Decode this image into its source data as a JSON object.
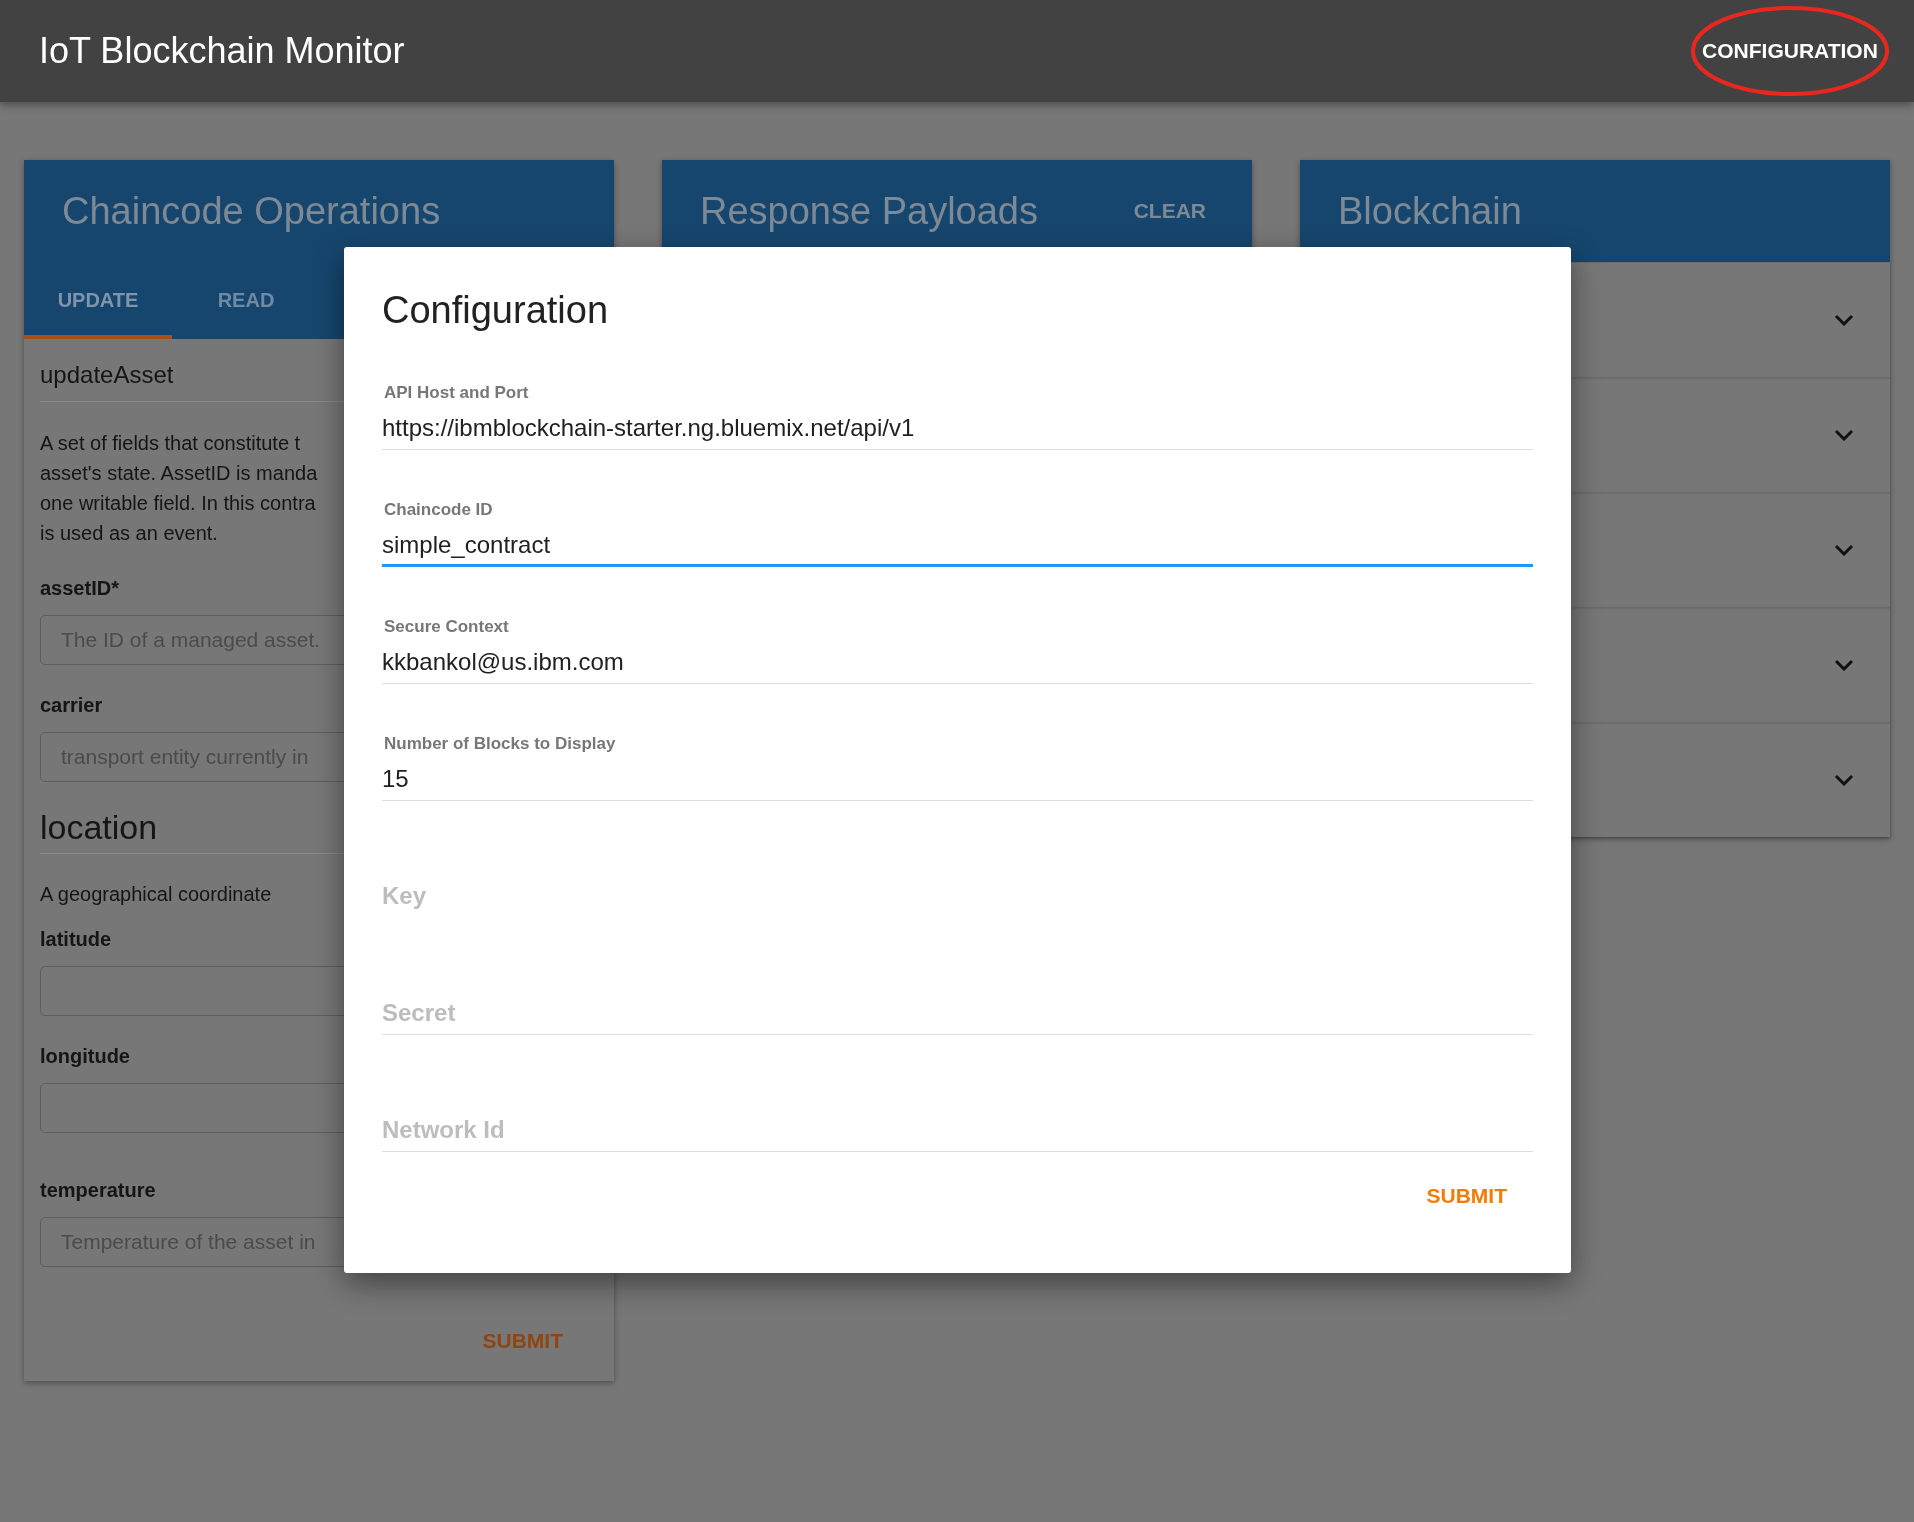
{
  "app_bar": {
    "title": "IoT Blockchain Monitor",
    "config_button": "CONFIGURATION",
    "highlighted": true
  },
  "panels": [
    {
      "kind": "operations",
      "title": "Chaincode Operations",
      "tabs": [
        {
          "label": "UPDATE",
          "selected": true
        },
        {
          "label": "READ",
          "selected": false
        }
      ],
      "function_name": "updateAsset",
      "description_lines": [
        "A set of fields that constitute t",
        "asset's state. AssetID is manda",
        "one writable field. In this contra",
        "is used as an event."
      ],
      "fields": [
        {
          "kind": "input",
          "label": "assetID*",
          "placeholder": "The ID of a managed asset."
        },
        {
          "kind": "input",
          "label": "carrier",
          "placeholder": "transport entity currently in"
        },
        {
          "kind": "section",
          "title": "location",
          "description": "A geographical coordinate",
          "children": [
            {
              "kind": "input",
              "label": "latitude"
            },
            {
              "kind": "input",
              "label": "longitude"
            }
          ]
        },
        {
          "kind": "input",
          "label": "temperature",
          "placeholder": "Temperature of the asset in"
        }
      ],
      "submit": "SUBMIT"
    },
    {
      "kind": "responses",
      "title": "Response Payloads",
      "action": "CLEAR"
    },
    {
      "kind": "blockchain",
      "title": "Blockchain",
      "blocks": [
        {
          "expanded": false
        },
        {
          "expanded": false
        },
        {
          "expanded": false
        },
        {
          "expanded": false
        },
        {
          "expanded": false
        }
      ]
    }
  ],
  "dialog": {
    "title": "Configuration",
    "fields": [
      {
        "label": "API Host and Port",
        "value": "https://ibmblockchain-starter.ng.bluemix.net/api/v1",
        "focused": false,
        "underlined": true
      },
      {
        "label": "Chaincode ID",
        "value": "simple_contract",
        "focused": true,
        "underlined": true
      },
      {
        "label": "Secure Context",
        "value": "kkbankol@us.ibm.com",
        "focused": false,
        "underlined": true
      },
      {
        "label": "Number of Blocks to Display",
        "value": "15",
        "focused": false,
        "underlined": true
      },
      {
        "placeholder": "Key",
        "focused": false,
        "underlined": false
      },
      {
        "placeholder": "Secret",
        "focused": false,
        "underlined": true
      },
      {
        "placeholder": "Network Id",
        "focused": false,
        "underlined": true
      }
    ],
    "submit": "SUBMIT"
  }
}
